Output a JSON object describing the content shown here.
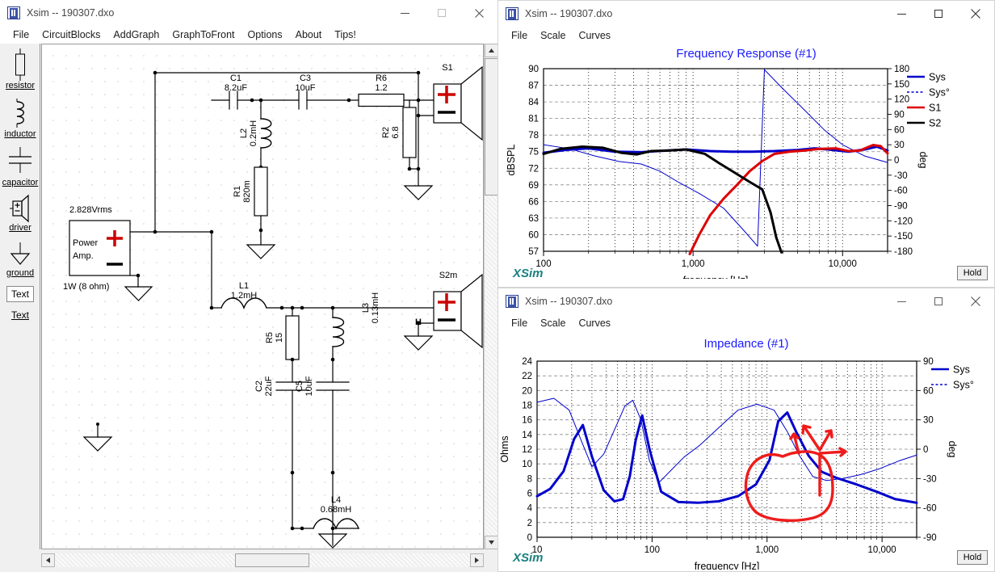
{
  "schematic_window": {
    "title": "Xsim -- 190307.dxo",
    "icon": "xsim-app-icon",
    "menu": [
      "File",
      "CircuitBlocks",
      "AddGraph",
      "GraphToFront",
      "Options",
      "About",
      "Tips!"
    ],
    "window_buttons": {
      "minimize": "minimize-icon",
      "maximize": "maximize-icon",
      "close": "close-icon"
    },
    "palette": [
      {
        "label": "resistor",
        "icon": "resistor-icon"
      },
      {
        "label": "inductor",
        "icon": "inductor-icon"
      },
      {
        "label": "capacitor",
        "icon": "capacitor-icon"
      },
      {
        "label": "driver",
        "icon": "driver-icon"
      },
      {
        "label": "ground",
        "icon": "ground-icon"
      },
      {
        "label": "Text",
        "icon": "text-box-icon"
      },
      {
        "label": "Text",
        "icon": "text-label-icon"
      }
    ],
    "circuit": {
      "source": {
        "top_label": "2.828Vrms",
        "body_line1": "Power",
        "body_line2": "Amp.",
        "bottom_label": "1W (8 ohm)",
        "plus": "+",
        "minus": "−"
      },
      "components": [
        {
          "ref": "C1",
          "value": "8.2uF",
          "type": "capacitor"
        },
        {
          "ref": "C3",
          "value": "10uF",
          "type": "capacitor"
        },
        {
          "ref": "R6",
          "value": "1.2",
          "type": "resistor"
        },
        {
          "ref": "L2",
          "value": "0.2mH",
          "type": "inductor"
        },
        {
          "ref": "R1",
          "value": "820m",
          "type": "resistor"
        },
        {
          "ref": "R2",
          "value": "6.8",
          "type": "resistor"
        },
        {
          "ref": "L1",
          "value": "1.2mH",
          "type": "inductor"
        },
        {
          "ref": "R5",
          "value": "15",
          "type": "resistor"
        },
        {
          "ref": "L3",
          "value": "0.13mH",
          "type": "inductor"
        },
        {
          "ref": "C2",
          "value": "22uF",
          "type": "capacitor"
        },
        {
          "ref": "C5",
          "value": "10uF",
          "type": "capacitor"
        },
        {
          "ref": "L4",
          "value": "0.68mH",
          "type": "inductor"
        }
      ],
      "drivers": [
        {
          "ref": "S1",
          "polarity_plus": "+",
          "polarity_minus": "−",
          "flag": ""
        },
        {
          "ref": "S2m",
          "polarity_plus": "+",
          "polarity_minus": "−",
          "flag": "H"
        }
      ]
    }
  },
  "frequency_window": {
    "title": "Xsim -- 190307.dxo",
    "icon": "xsim-app-icon",
    "menu": [
      "File",
      "Scale",
      "Curves"
    ],
    "window_buttons": {
      "minimize": "minimize-icon",
      "maximize": "maximize-icon",
      "close": "close-icon"
    },
    "logo": "XSim",
    "hold_label": "Hold"
  },
  "impedance_window": {
    "title": "Xsim -- 190307.dxo",
    "icon": "xsim-app-icon",
    "menu": [
      "File",
      "Scale",
      "Curves"
    ],
    "window_buttons": {
      "minimize": "minimize-icon",
      "maximize": "maximize-icon",
      "close": "close-icon"
    },
    "logo": "XSim",
    "hold_label": "Hold"
  },
  "chart_data": [
    {
      "id": "frequency-response",
      "type": "line",
      "title": "Frequency Response (#1)",
      "xlabel": "frequency [Hz]",
      "ylabel": "dBSPL",
      "y2label": "deg",
      "xscale": "log",
      "xlim": [
        100,
        20000
      ],
      "xticks": [
        100,
        1000,
        10000
      ],
      "xticklabels": [
        "100",
        "1,000",
        "10,000"
      ],
      "ylim": [
        57,
        90
      ],
      "yticks": [
        57,
        60,
        63,
        66,
        69,
        72,
        75,
        78,
        81,
        84,
        87,
        90
      ],
      "y2lim": [
        -180,
        180
      ],
      "y2ticks": [
        -180,
        -150,
        -120,
        -90,
        -60,
        -30,
        0,
        30,
        60,
        90,
        120,
        150,
        180
      ],
      "grid": true,
      "legend_position": "right",
      "legend": [
        {
          "name": "Sys",
          "color": "#0000cc",
          "style": "solid"
        },
        {
          "name": "Sys°",
          "color": "#0000cc",
          "style": "dashed"
        },
        {
          "name": "S1",
          "color": "#dd0000",
          "style": "solid"
        },
        {
          "name": "S2",
          "color": "#000000",
          "style": "solid"
        }
      ],
      "series": [
        {
          "name": "Sys",
          "color": "#0000cc",
          "axis": "left",
          "width": 3,
          "x": [
            100,
            140,
            200,
            300,
            450,
            650,
            900,
            1300,
            1800,
            2500,
            3500,
            5000,
            6500,
            8000,
            11000,
            14000,
            17000,
            20000
          ],
          "y": [
            74.8,
            75.3,
            75.6,
            75.0,
            74.9,
            75.2,
            75.4,
            75.1,
            75.0,
            75.0,
            75.1,
            75.3,
            75.6,
            75.4,
            75.0,
            75.4,
            75.9,
            75.2
          ]
        },
        {
          "name": "Sys°",
          "color": "#0000cc",
          "axis": "right",
          "width": 1,
          "x": [
            100,
            150,
            220,
            320,
            450,
            600,
            800,
            1100,
            1600,
            2200,
            2700,
            3000,
            4000,
            5500,
            7500,
            10000,
            14000,
            20000
          ],
          "y": [
            30,
            22,
            8,
            -3,
            -8,
            -22,
            -44,
            -66,
            -95,
            -140,
            -170,
            178,
            140,
            100,
            60,
            30,
            8,
            -5
          ]
        },
        {
          "name": "S1",
          "color": "#dd0000",
          "axis": "left",
          "width": 3,
          "x": [
            950,
            1100,
            1300,
            1600,
            2000,
            2400,
            2900,
            3500,
            4400,
            5500,
            7000,
            9000,
            11000,
            13000,
            16000,
            18000,
            20000
          ],
          "y": [
            56.5,
            60.0,
            63.5,
            66.5,
            69.2,
            71.5,
            73.3,
            74.6,
            75.0,
            75.2,
            75.5,
            75.6,
            75.1,
            75.2,
            76.2,
            76.0,
            74.7
          ]
        },
        {
          "name": "S2",
          "color": "#000000",
          "axis": "left",
          "width": 3,
          "x": [
            100,
            130,
            180,
            250,
            330,
            420,
            520,
            680,
            900,
            1200,
            1500,
            1900,
            2400,
            2900,
            3300,
            3600,
            3900
          ],
          "y": [
            74.6,
            75.5,
            75.9,
            75.7,
            74.8,
            74.5,
            75.1,
            75.2,
            75.4,
            74.6,
            72.9,
            71.2,
            69.5,
            68.2,
            64.0,
            59.5,
            56.8
          ]
        }
      ]
    },
    {
      "id": "impedance",
      "type": "line",
      "title": "Impedance (#1)",
      "xlabel": "frequency [Hz]",
      "ylabel": "Ohms",
      "y2label": "deg",
      "xscale": "log",
      "xlim": [
        10,
        20000
      ],
      "xticks": [
        10,
        100,
        1000,
        10000
      ],
      "xticklabels": [
        "10",
        "100",
        "1,000",
        "10,000"
      ],
      "ylim": [
        0,
        24
      ],
      "yticks": [
        0,
        2,
        4,
        6,
        8,
        10,
        12,
        14,
        16,
        18,
        20,
        22,
        24
      ],
      "y2lim": [
        -90,
        90
      ],
      "y2ticks": [
        -90,
        -60,
        -30,
        0,
        30,
        60,
        90
      ],
      "grid": true,
      "legend_position": "right",
      "legend": [
        {
          "name": "Sys",
          "color": "#0000cc",
          "style": "solid"
        },
        {
          "name": "Sys°",
          "color": "#0000cc",
          "style": "dashed"
        }
      ],
      "series": [
        {
          "name": "Sys",
          "color": "#0000cc",
          "axis": "left",
          "width": 3,
          "x": [
            10,
            13,
            17,
            21,
            25,
            30,
            38,
            47,
            56,
            64,
            72,
            82,
            95,
            120,
            170,
            250,
            380,
            560,
            800,
            1050,
            1250,
            1500,
            1800,
            2300,
            3000,
            4000,
            6000,
            9000,
            13000,
            20000
          ],
          "y": [
            5.6,
            6.6,
            9.0,
            13.4,
            15.3,
            11.0,
            6.4,
            4.9,
            5.2,
            8.3,
            13.2,
            16.6,
            12.0,
            6.2,
            4.8,
            4.7,
            4.9,
            5.6,
            7.2,
            10.5,
            15.8,
            17.0,
            14.3,
            11.1,
            8.9,
            8.1,
            7.2,
            6.2,
            5.2,
            4.7
          ]
        },
        {
          "name": "Sys°",
          "color": "#0000cc",
          "axis": "right",
          "width": 1,
          "x": [
            10,
            14,
            19,
            24,
            30,
            38,
            48,
            58,
            68,
            80,
            95,
            115,
            145,
            190,
            260,
            380,
            560,
            820,
            1150,
            1500,
            1900,
            2500,
            3300,
            4500,
            6500,
            9500,
            14000,
            20000
          ],
          "y": [
            48,
            52,
            40,
            10,
            -18,
            -5,
            22,
            44,
            50,
            30,
            -12,
            -34,
            -22,
            -8,
            4,
            22,
            40,
            46,
            40,
            18,
            -6,
            -28,
            -32,
            -30,
            -26,
            -20,
            -12,
            -6
          ]
        }
      ],
      "annotation": {
        "type": "freehand-markup",
        "color": "#ee1c1c",
        "description": "hand-drawn red circle with arrows pointing at the 1.5k-4k region"
      }
    }
  ]
}
